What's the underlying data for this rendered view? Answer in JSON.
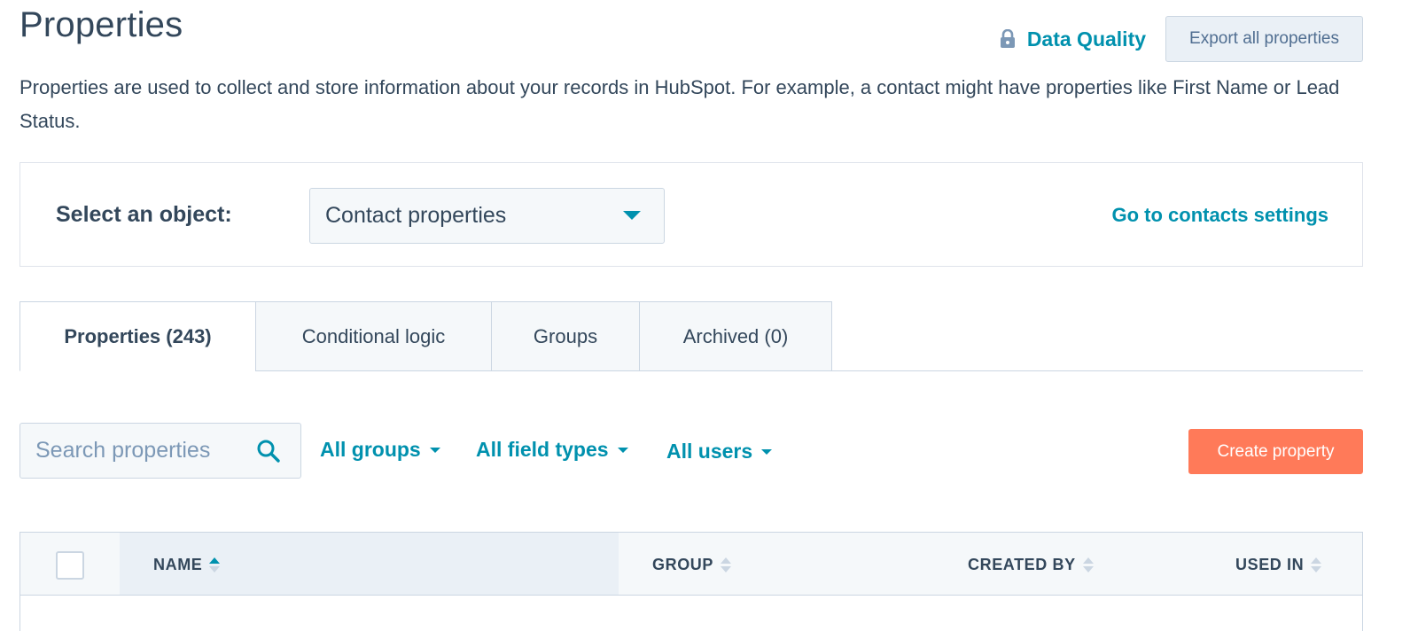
{
  "page": {
    "title": "Properties",
    "description": "Properties are used to collect and store information about your records in HubSpot. For example, a contact might have properties like First Name or Lead Status."
  },
  "header": {
    "data_quality_label": "Data Quality",
    "export_label": "Export all properties"
  },
  "object_panel": {
    "label": "Select an object:",
    "selected_object": "Contact properties",
    "settings_link": "Go to contacts settings"
  },
  "tabs": [
    {
      "label": "Properties (243)",
      "active": true
    },
    {
      "label": "Conditional logic",
      "active": false
    },
    {
      "label": "Groups",
      "active": false
    },
    {
      "label": "Archived (0)",
      "active": false
    }
  ],
  "filters": {
    "search_placeholder": "Search properties",
    "groups_label": "All groups",
    "field_types_label": "All field types",
    "users_label": "All users",
    "create_label": "Create property"
  },
  "table": {
    "columns": [
      "NAME",
      "GROUP",
      "CREATED BY",
      "USED IN"
    ],
    "sorted_column": "NAME"
  },
  "colors": {
    "accent": "#0091ae",
    "primary_button": "#ff7a59",
    "text": "#33475b",
    "border": "#cbd6e2"
  }
}
